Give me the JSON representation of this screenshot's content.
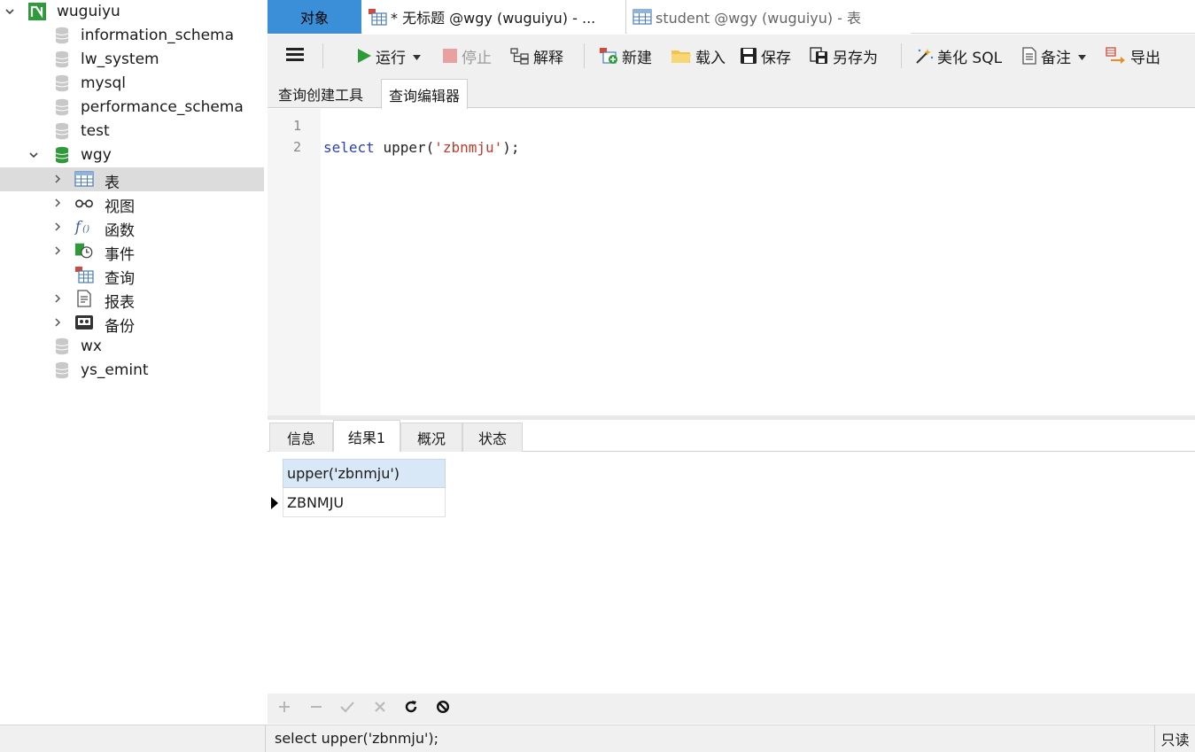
{
  "sidebar": {
    "connection": "wuguiyu",
    "databases": [
      "information_schema",
      "lw_system",
      "mysql",
      "performance_schema",
      "test"
    ],
    "open_database": "wgy",
    "object_groups": [
      "表",
      "视图",
      "函数",
      "事件",
      "查询",
      "报表",
      "备份"
    ],
    "more_databases": [
      "wx",
      "ys_emint"
    ]
  },
  "doc_tabs": {
    "objects": "对象",
    "query": "* 无标题 @wgy (wuguiyu) - ...",
    "student": "student @wgy (wuguiyu) - 表"
  },
  "toolbar": {
    "run": "运行",
    "stop": "停止",
    "explain": "解释",
    "new": "新建",
    "load": "载入",
    "save": "保存",
    "save_as": "另存为",
    "beautify": "美化 SQL",
    "comment": "备注",
    "export": "导出"
  },
  "editor_tabs": {
    "builder": "查询创建工具",
    "editor": "查询编辑器"
  },
  "editor": {
    "line_numbers": [
      "1",
      "2"
    ],
    "code_keyword": "select",
    "code_function": "upper(",
    "code_string": "'zbnmju'",
    "code_end": ");"
  },
  "result_tabs": {
    "info": "信息",
    "result1": "结果1",
    "profile": "概况",
    "status": "状态"
  },
  "result_grid": {
    "column": "upper('zbnmju')",
    "value": "ZBNMJU"
  },
  "status_bar": {
    "sql": "select upper('zbnmju');",
    "mode": "只读"
  },
  "colors": {
    "active_tab": "#3a8fd8",
    "selected_row": "#dcdcdc",
    "grid_header": "#d9e8f6",
    "db_open": "#2e9a3a",
    "keyword": "#2a3fb8",
    "string": "#c0392b"
  },
  "icons": {
    "connection": "mysql-connection-icon",
    "database": "database-icon",
    "table": "table-icon",
    "view": "view-icon",
    "function": "function-icon",
    "event": "event-icon",
    "query": "query-icon",
    "report": "report-icon",
    "backup": "backup-icon"
  }
}
